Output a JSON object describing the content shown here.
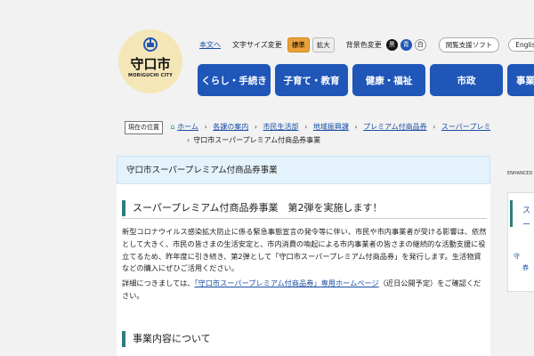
{
  "logo": {
    "city": "守口市",
    "city_en": "MORIGUCHI CITY"
  },
  "toolbar": {
    "english_text": "本文へ",
    "font_size_label": "文字サイズ変更",
    "font_standard": "標準",
    "font_large": "拡大",
    "bg_label": "背景色変更",
    "bg_black": "黒",
    "bg_blue": "青",
    "bg_white": "白",
    "reader_support": "閲覧支援ソフト",
    "english": "English"
  },
  "nav": [
    "くらし・手続き",
    "子育て・教育",
    "健康・福祉",
    "市政",
    "事業"
  ],
  "breadcrumb": {
    "label": "現在の位置",
    "items": [
      "ホーム",
      "各課の案内",
      "市民生活部",
      "地域振興課",
      "プレミアム付商品券",
      "スーパープレミ"
    ],
    "current": "守口市スーパープレミアム付商品券事業"
  },
  "page_title": "守口市スーパープレミアム付商品券事業",
  "heading": "スーパープレミアム付商品券事業　第2弾を実施します！",
  "paragraph1": "新型コロナウイルス感染拡大防止に係る緊急事態宣言の発令等に伴い、市民や市内事業者が受ける影響は、依然として大きく、市民の皆さまの生活安定と、市内消費の喚起による市内事業者の皆さまの継続的な活動支援に役立てるため、昨年度に引き続き、第2弾として「守口市スーパープレミアム付商品券」を発行します。生活物資などの購入にぜひご活用ください。",
  "paragraph2": {
    "before": "詳細につきましては、",
    "link": "「守口市スーパープレミアム付商品券」専用ホームページ",
    "after": "（近日公開予定）をご確認ください。"
  },
  "section_heading": "事業内容について",
  "side": {
    "enhanced": "ENHANCED",
    "t1": "ス",
    "t2": "ー",
    "b1": "守",
    "b2": "券"
  }
}
